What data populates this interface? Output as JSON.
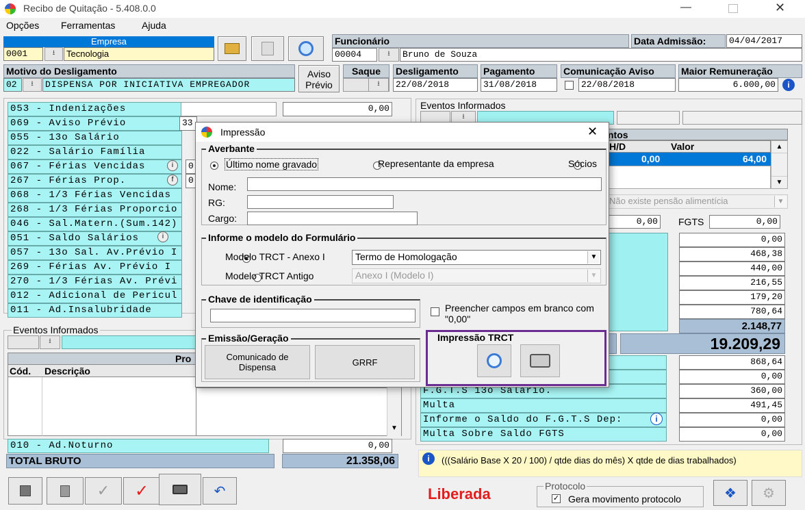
{
  "window": {
    "title": "Recibo de Quitação - 5.408.0.0"
  },
  "menu": [
    "Opções",
    "Ferramentas",
    "Ajuda"
  ],
  "empresa": {
    "label": "Empresa",
    "code": "0001",
    "name": "Tecnologia"
  },
  "funcionario": {
    "label": "Funcionário",
    "code": "00004",
    "name": "Bruno de Souza"
  },
  "admissao": {
    "label": "Data Admissão:",
    "value": "04/04/2017"
  },
  "motivo": {
    "label": "Motivo do Desligamento",
    "code": "02",
    "value": "DISPENSA POR INICIATIVA EMPREGADOR"
  },
  "aviso_previo_btn": [
    "Aviso",
    "Prévio"
  ],
  "dates": {
    "saque": "Saque",
    "desligamento": {
      "label": "Desligamento",
      "value": "22/08/2018"
    },
    "pagamento": {
      "label": "Pagamento",
      "value": "31/08/2018"
    },
    "comunicacao": {
      "label": "Comunicação Aviso",
      "value": "22/08/2018"
    },
    "maior": {
      "label": "Maior Remuneração",
      "value": "6.000,00"
    }
  },
  "left_events": [
    "053 - Indenizações",
    "069 - Aviso Prévio",
    "055 - 13o Salário",
    "022 - Salário Família",
    "067 - Férias Vencidas",
    "267 - Férias Prop.",
    "068 - 1/3 Férias Vencidas",
    "268 - 1/3 Férias Proporcio",
    "046 - Sal.Matern.(Sum.142)",
    "051 - Saldo Salários",
    "057 - 13o Sal. Av.Prévio I",
    "269 -  Férias  Av. Prévio I",
    "270 - 1/3 Férias Av. Prévi",
    "012 - Adicional de Pericul",
    "011 - Ad.Insalubridade"
  ],
  "left_top_value": "0,00",
  "left_partial": {
    "aviso_val": "33",
    "ferias_val": "0",
    "ferias_prop_val": "0"
  },
  "eventos_informados_label": "Eventos Informados",
  "lower_table": {
    "header": "Pro",
    "cols": [
      "Cód.",
      "Descrição"
    ]
  },
  "ad_noturno": {
    "label": "010 - Ad.Noturno",
    "value": "0,00"
  },
  "total_bruto": {
    "label": "TOTAL BRUTO",
    "value": "21.358,06"
  },
  "right_panel": {
    "eventos_label": "Eventos Informados",
    "ntos": "ntos",
    "hd": "H/D",
    "valor": "Valor",
    "row_hd": "0,00",
    "row_valor": "64,00",
    "pensao": "Não existe pensão alimentícia",
    "mid_val": "0,00",
    "fgts_label": "FGTS",
    "fgts_val": "0,00",
    "values": [
      "0,00",
      "468,38",
      "440,00",
      "216,55",
      "179,20",
      "780,64"
    ],
    "subtotal": "2.148,77",
    "big_total": "19.209,29",
    "lower_values": [
      "868,64",
      "0,00",
      "360,00",
      "491,45",
      "0,00",
      "0,00"
    ],
    "lower_labels": [
      "F.G.T.S  13o Salário.",
      "Multa",
      "Informe o Saldo do F.G.T.S Dep:",
      "Multa Sobre Saldo FGTS"
    ],
    "info_text": "(((Salário Base X 20 / 100) / qtde dias do mês) X qtde de dias trabalhados)",
    "liberada": "Liberada",
    "protocolo": {
      "label": "Protocolo",
      "check_label": "Gera movimento protocolo"
    }
  },
  "dialog": {
    "title": "Impressão",
    "averbante": {
      "title": "Averbante",
      "options": [
        "Último nome gravado",
        "Representante da empresa",
        "Sócios"
      ],
      "nome": "Nome:",
      "rg": "RG:",
      "cargo": "Cargo:"
    },
    "modelo": {
      "title": "Informe o modelo do Formulário",
      "opt1": "Modelo TRCT - Anexo I",
      "sel1": "Termo de Homologação",
      "opt2": "Modelo TRCT Antigo",
      "sel2": "Anexo I (Modelo I)"
    },
    "chave": {
      "title": "Chave de identificação"
    },
    "preencher": "Preencher campos em branco com \"0,00\"",
    "emissao": {
      "title": "Emissão/Geração",
      "btn1": "Comunicado de Dispensa",
      "btn2": "GRRF"
    },
    "impressao": {
      "title": "Impressão TRCT"
    }
  },
  "colors": {
    "cyan": "#a8f4f4",
    "highlight": "#6a2c91",
    "selected": "#0078d7",
    "liberada": "#e31d1d"
  }
}
